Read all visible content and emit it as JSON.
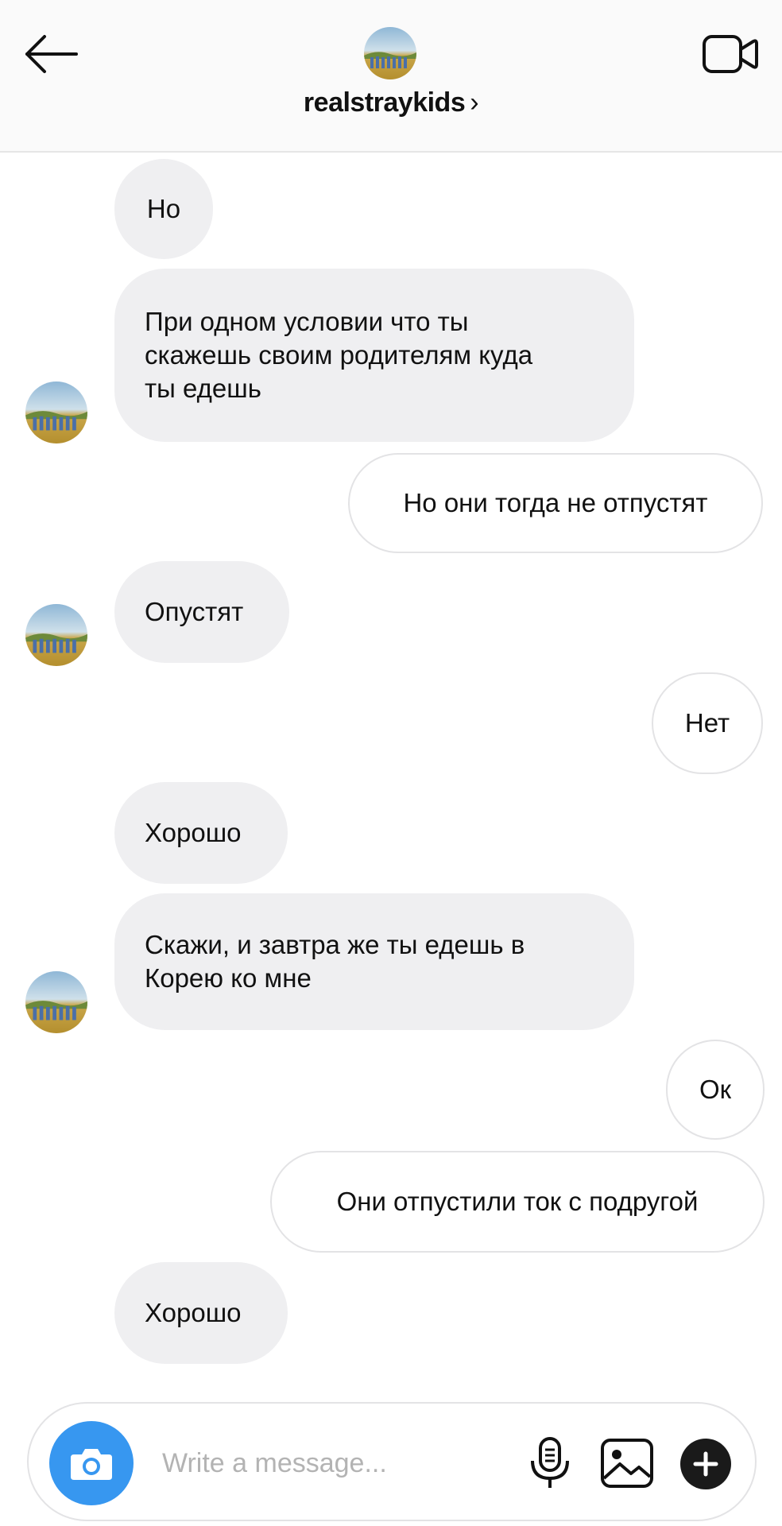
{
  "header": {
    "username": "realstraykids",
    "chevron": "›",
    "back_icon": "arrow-left-icon",
    "video_icon": "video-camera-icon",
    "avatar": "group-photo-avatar"
  },
  "messages": [
    {
      "direction": "in",
      "text": "Но"
    },
    {
      "direction": "in",
      "text": "При одном условии что ты скажешь своим родителям куда ты едешь"
    },
    {
      "direction": "out",
      "text": "Но они тогда не отпустят"
    },
    {
      "direction": "in",
      "text": "Опустят"
    },
    {
      "direction": "out",
      "text": "Нет"
    },
    {
      "direction": "in",
      "text": "Хорошо"
    },
    {
      "direction": "in",
      "text": "Скажи, и завтра же ты едешь в Корею ко мне"
    },
    {
      "direction": "out",
      "text": "Ок"
    },
    {
      "direction": "out",
      "text": "Они отпустили ток с подругой"
    },
    {
      "direction": "in",
      "text": "Хорошо"
    }
  ],
  "composer": {
    "placeholder": "Write a message...",
    "camera_icon": "camera-icon",
    "mic_icon": "microphone-icon",
    "gallery_icon": "image-gallery-icon",
    "plus_icon": "plus-icon"
  },
  "colors": {
    "accent": "#3797f0",
    "incoming_bubble": "#efeff1",
    "outgoing_border": "#e3e3e5",
    "header_bg": "#fafafa"
  }
}
